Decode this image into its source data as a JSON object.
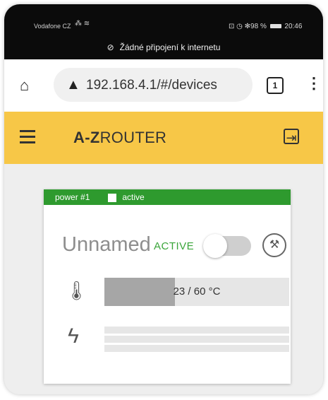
{
  "status_bar": {
    "carrier": "Vodafone CZ",
    "signal": "⁂ ≋",
    "right": "⊡ ◷ ✻98 %",
    "time": "20:46",
    "offline_message": "Žádné připojení k internetu"
  },
  "browser": {
    "url": "192.168.4.1/#/devices",
    "tab_count": "1"
  },
  "app": {
    "brand_bold": "A-Z",
    "brand_rest": "ROUTER"
  },
  "device": {
    "header_id": "power #1",
    "header_status": "active",
    "name": "Unnamed",
    "state_label": "ACTIVE",
    "toggle_on": false,
    "temperature_text": "23 / 60 °C",
    "temperature_fraction": 0.38,
    "power_bars": [
      0,
      0,
      0
    ]
  },
  "colors": {
    "appbar": "#f7c747",
    "card_header": "#2e9a2e",
    "active_text": "#3aa53a"
  },
  "icons": [
    "no-network-icon",
    "home-icon",
    "warning-icon",
    "tabs-icon",
    "more-icon",
    "menu-icon",
    "logout-icon",
    "chip-icon",
    "wrench-icon",
    "thermometer-icon",
    "bolt-icon"
  ]
}
